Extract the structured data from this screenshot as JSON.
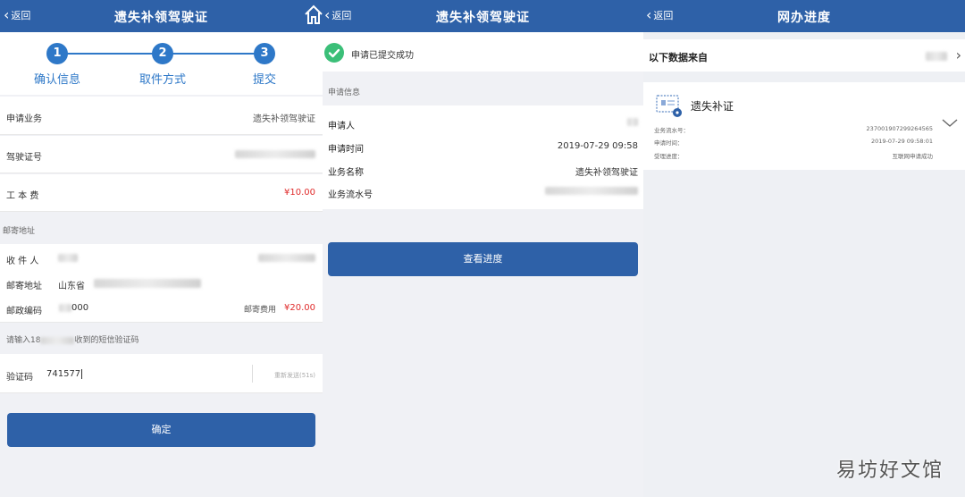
{
  "panel1": {
    "back_label": "返回",
    "title": "遗失补领驾驶证",
    "steps": [
      {
        "num": "1",
        "label": "确认信息"
      },
      {
        "num": "2",
        "label": "取件方式"
      },
      {
        "num": "3",
        "label": "提交"
      }
    ],
    "business_label": "申请业务",
    "business_value": "遗失补领驾驶证",
    "license_label": "驾驶证号",
    "fee_label": "工 本 费",
    "fee_value": "¥10.00",
    "mail_section": "邮寄地址",
    "recipient_label": "收 件 人",
    "address_label": "邮寄地址",
    "address_prefix": "山东省",
    "postcode_label": "邮政编码",
    "postcode_value": "000",
    "postage_label": "邮寄费用",
    "postage_value": "¥20.00",
    "sms_prompt_prefix": "请输入18",
    "sms_prompt_suffix": "收到的短信验证码",
    "code_label": "验证码",
    "code_value": "741577",
    "resend_label": "重新发送(51s)",
    "confirm_label": "确定"
  },
  "panel2": {
    "back_label": "返回",
    "title": "遗失补领驾驶证",
    "success_text": "申请已提交成功",
    "section_title": "申请信息",
    "applicant_label": "申请人",
    "time_label": "申请时间",
    "time_value": "2019-07-29 09:58",
    "bizname_label": "业务名称",
    "bizname_value": "遗失补领驾驶证",
    "serial_label": "业务流水号",
    "progress_button": "查看进度"
  },
  "panel3": {
    "back_label": "返回",
    "title": "网办进度",
    "source_label": "以下数据来自",
    "item_title": "遗失补证",
    "serial_label": "业务流水号：",
    "serial_value": "2370019072992645​65",
    "time_label": "申请时间：",
    "time_value": "2019-07-29 09:58:01",
    "status_label": "受理进度：",
    "status_value": "互联网申请成功"
  },
  "watermark": "易坊好文馆",
  "colors": {
    "primary": "#2e61a8",
    "step_blue": "#2e78c8",
    "price_red": "#e02b2b",
    "success_green": "#3bbf78"
  }
}
